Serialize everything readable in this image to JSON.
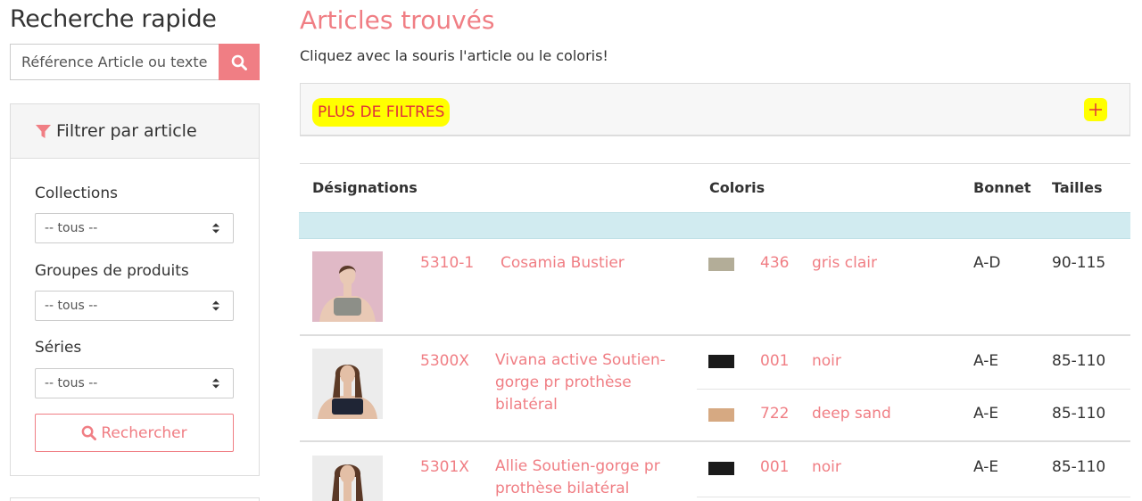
{
  "sidebar": {
    "title": "Recherche rapide",
    "search": {
      "placeholder": "Référence Article ou texte",
      "value": ""
    },
    "search_button_icon": "search-icon",
    "filter": {
      "title": "Filtrer par article",
      "title_icon": "filter-icon",
      "collections": {
        "label": "Collections",
        "value": "-- tous --"
      },
      "groups": {
        "label": "Groupes de produits",
        "value": "-- tous --"
      },
      "series": {
        "label": "Séries",
        "value": "-- tous --"
      },
      "submit_label": "Rechercher"
    }
  },
  "main": {
    "title": "Articles trouvés",
    "subtitle": "Cliquez avec la souris l'article ou le coloris!",
    "more_filters_label": "PLUS DE FILTRES",
    "more_filters_icon": "plus-icon",
    "table": {
      "headers": {
        "designation": "Désignations",
        "color": "Coloris",
        "cup": "Bonnet",
        "sizes": "Tailles"
      },
      "rows": [
        {
          "ref": "5310-1",
          "name": "Cosamia Bustier",
          "variants": [
            {
              "code": "436",
              "color": "gris clair",
              "swatch": "#b3ad98",
              "cup": "A-D",
              "sizes": "90-115"
            }
          ]
        },
        {
          "ref": "5300X",
          "name": "Vivana active Soutien-gorge pr prothèse bilatéral",
          "variants": [
            {
              "code": "001",
              "color": "noir",
              "swatch": "#1a1a1a",
              "cup": "A-E",
              "sizes": "85-110"
            },
            {
              "code": "722",
              "color": "deep sand",
              "swatch": "#d6a982",
              "cup": "A-E",
              "sizes": "85-110"
            }
          ]
        },
        {
          "ref": "5301X",
          "name": "Allie Soutien-gorge pr prothèse bilatéral",
          "variants": [
            {
              "code": "001",
              "color": "noir",
              "swatch": "#1a1a1a",
              "cup": "A-E",
              "sizes": "85-110"
            }
          ]
        }
      ]
    }
  },
  "colors": {
    "accent": "#f07e84",
    "highlight": "#ffff00",
    "highlight_text": "#e0303a",
    "info_row": "#d1ebf0"
  }
}
